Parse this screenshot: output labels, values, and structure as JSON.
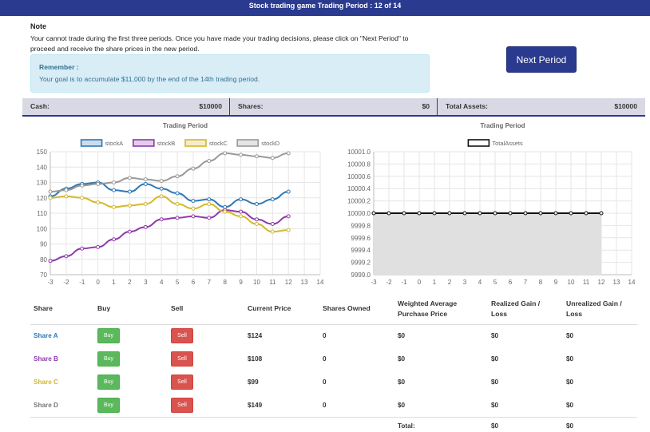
{
  "header": {
    "title": "Stock trading game Trading Period : 12 of 14"
  },
  "note": {
    "title": "Note",
    "text": "Your cannot trade during the first three periods. Once you have made your trading decisions, please click on \"Next Period\" to proceed and receive the share prices in the new period."
  },
  "remember": {
    "title": "Remember :",
    "text": "Your goal is to accumulate $11,000 by the end of the 14th trading period."
  },
  "next_button": {
    "label": "Next Period"
  },
  "summary": {
    "cash_label": "Cash:",
    "cash_value": "$10000",
    "shares_label": "Shares:",
    "shares_value": "$0",
    "assets_label": "Total Assets:",
    "assets_value": "$10000"
  },
  "colors": {
    "accent": "#2a3a8f",
    "stockA": "#2f78b5",
    "stockB": "#8e3aab",
    "stockC": "#d4b82e",
    "stockD": "#999999",
    "total": "#111111",
    "buy": "#5cb85c",
    "sell": "#d9534f"
  },
  "chart_data": [
    {
      "type": "line",
      "title": "Trading Period",
      "x": [
        -3,
        -2,
        -1,
        0,
        1,
        2,
        3,
        4,
        5,
        6,
        7,
        8,
        9,
        10,
        11,
        12
      ],
      "xticks": [
        -3,
        -2,
        -1,
        0,
        1,
        2,
        3,
        4,
        5,
        6,
        7,
        8,
        9,
        10,
        11,
        12,
        13,
        14
      ],
      "ylim": [
        70,
        150
      ],
      "yticks": [
        70,
        80,
        90,
        100,
        110,
        120,
        130,
        140,
        150
      ],
      "legend": "top",
      "grid": true,
      "series": [
        {
          "name": "stockA",
          "values": [
            121,
            126,
            129,
            130,
            125,
            124,
            129,
            126,
            123,
            118,
            119,
            114,
            119,
            116,
            119,
            124
          ]
        },
        {
          "name": "stockB",
          "values": [
            79,
            82,
            87,
            88,
            93,
            98,
            101,
            106,
            107,
            108,
            107,
            112,
            111,
            106,
            103,
            108
          ]
        },
        {
          "name": "stockC",
          "values": [
            120,
            121,
            120,
            117,
            114,
            115,
            116,
            121,
            116,
            113,
            116,
            111,
            108,
            103,
            98,
            99
          ]
        },
        {
          "name": "stockD",
          "values": [
            124,
            125,
            128,
            129,
            130,
            133,
            132,
            131,
            134,
            139,
            144,
            149,
            148,
            147,
            146,
            149
          ]
        }
      ]
    },
    {
      "type": "area",
      "title": "Trading Period",
      "x": [
        -3,
        -2,
        -1,
        0,
        1,
        2,
        3,
        4,
        5,
        6,
        7,
        8,
        9,
        10,
        11,
        12
      ],
      "xticks": [
        -3,
        -2,
        -1,
        0,
        1,
        2,
        3,
        4,
        5,
        6,
        7,
        8,
        9,
        10,
        11,
        12,
        13,
        14
      ],
      "ylim": [
        9999.0,
        10001.0
      ],
      "yticks": [
        "9999.0",
        "9999.2",
        "9999.4",
        "9999.6",
        "9999.8",
        "10000.0",
        "10000.2",
        "10000.4",
        "10000.6",
        "10000.8",
        "10001.0"
      ],
      "legend": "top",
      "grid": true,
      "series": [
        {
          "name": "TotalAssets",
          "values": [
            10000,
            10000,
            10000,
            10000,
            10000,
            10000,
            10000,
            10000,
            10000,
            10000,
            10000,
            10000,
            10000,
            10000,
            10000,
            10000
          ]
        }
      ]
    }
  ],
  "table": {
    "headers": {
      "share": "Share",
      "buy": "Buy",
      "sell": "Sell",
      "price": "Current Price",
      "owned": "Shares Owned",
      "wapp_1": "Weighted Average",
      "wapp_2": "Purchase Price",
      "realized_1": "Realized Gain /",
      "realized_2": "Loss",
      "unrealized_1": "Unrealized Gain /",
      "unrealized_2": "Loss"
    },
    "buy_label": "Buy",
    "sell_label": "Sell",
    "rows": [
      {
        "share": "Share A",
        "price": "$124",
        "owned": "0",
        "wapp": "$0",
        "realized": "$0",
        "unrealized": "$0"
      },
      {
        "share": "Share B",
        "price": "$108",
        "owned": "0",
        "wapp": "$0",
        "realized": "$0",
        "unrealized": "$0"
      },
      {
        "share": "Share C",
        "price": "$99",
        "owned": "0",
        "wapp": "$0",
        "realized": "$0",
        "unrealized": "$0"
      },
      {
        "share": "Share D",
        "price": "$149",
        "owned": "0",
        "wapp": "$0",
        "realized": "$0",
        "unrealized": "$0"
      }
    ],
    "total_label": "Total:",
    "total_realized": "$0",
    "total_unrealized": "$0"
  }
}
